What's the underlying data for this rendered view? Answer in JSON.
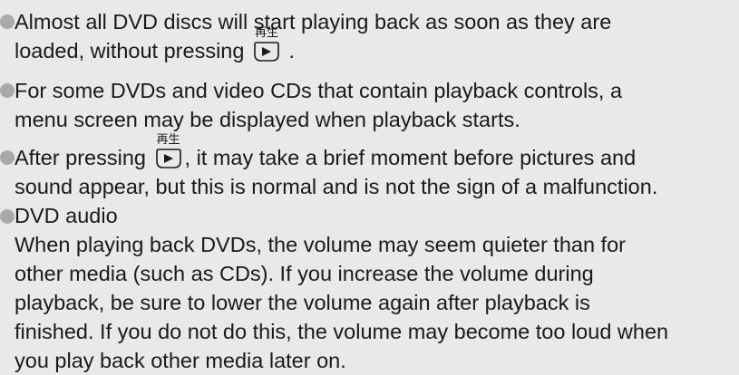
{
  "key_label": "再生",
  "notes": [
    {
      "lines": [
        [
          "Almost all DVD discs will start playing back as soon as they are"
        ],
        [
          "loaded, without pressing ",
          "{key}",
          " ."
        ]
      ]
    },
    {
      "lines": [
        [
          "For some DVDs and video CDs that contain playback controls, a"
        ],
        [
          "menu screen may be displayed when playback starts."
        ]
      ]
    },
    {
      "lines": [
        [
          "After pressing ",
          "{key}",
          ", it may take a brief moment before pictures and"
        ],
        [
          "sound appear, but this is normal and is not the sign of a malfunction."
        ]
      ]
    },
    {
      "lines": [
        [
          "DVD audio"
        ],
        [
          "When playing back DVDs, the volume may seem quieter than for"
        ],
        [
          "other media (such as CDs). If you increase the volume during"
        ],
        [
          "playback, be sure to lower the volume again after playback is"
        ],
        [
          "finished. If you do not do this, the volume may become too loud when"
        ],
        [
          "you play back other media later on."
        ]
      ]
    }
  ]
}
